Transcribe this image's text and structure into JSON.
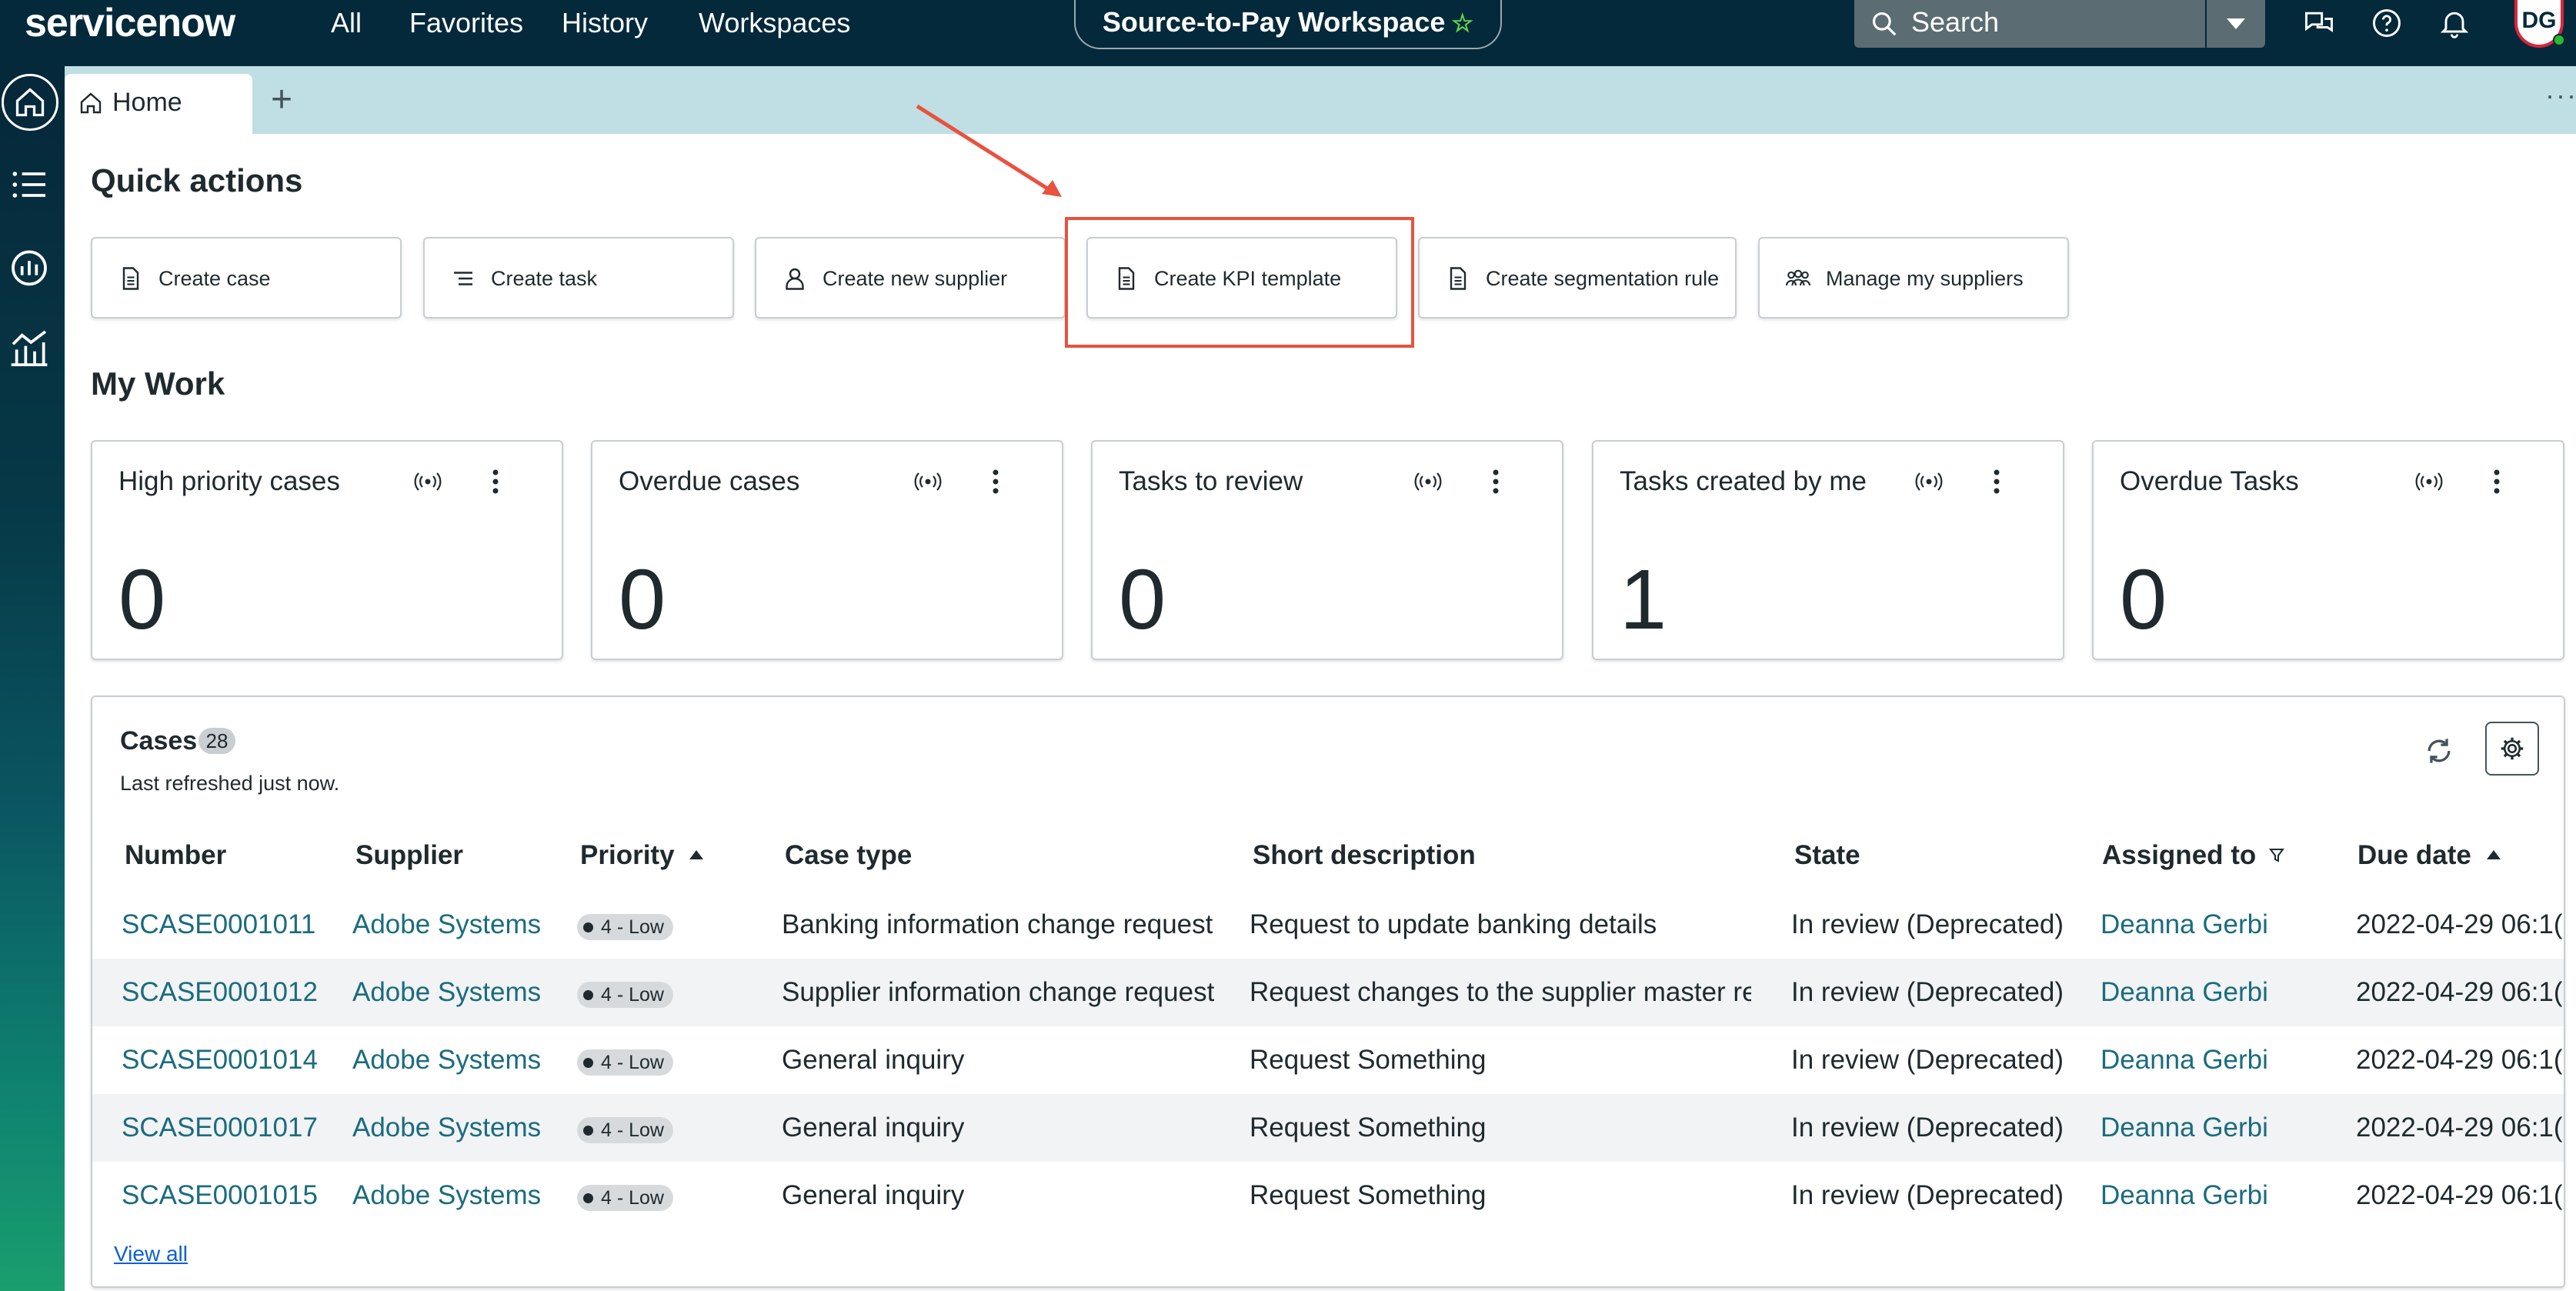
{
  "topnav": {
    "logo": "servicenow",
    "links": [
      "All",
      "Favorites",
      "History",
      "Workspaces"
    ],
    "workspace": "Source-to-Pay Workspace",
    "search_placeholder": "Search",
    "avatar_initials": "DG"
  },
  "tabs": {
    "home_label": "Home",
    "add_label": "+",
    "more_label": "···"
  },
  "quick_actions": {
    "title": "Quick actions",
    "items": [
      {
        "label": "Create case",
        "icon": "document-icon"
      },
      {
        "label": "Create task",
        "icon": "list-icon"
      },
      {
        "label": "Create new supplier",
        "icon": "person-icon"
      },
      {
        "label": "Create KPI template",
        "icon": "document-icon"
      },
      {
        "label": "Create segmentation rule",
        "icon": "document-icon"
      },
      {
        "label": "Manage my suppliers",
        "icon": "group-icon"
      }
    ],
    "highlight_color": "#e8523f"
  },
  "my_work": {
    "title": "My Work",
    "cards": [
      {
        "title": "High priority cases",
        "value": "0"
      },
      {
        "title": "Overdue cases",
        "value": "0"
      },
      {
        "title": "Tasks to review",
        "value": "0"
      },
      {
        "title": "Tasks created by me",
        "value": "1"
      },
      {
        "title": "Overdue Tasks",
        "value": "0"
      }
    ]
  },
  "cases": {
    "title": "Cases",
    "count": "28",
    "subtitle": "Last refreshed just now.",
    "columns": [
      "Number",
      "Supplier",
      "Priority",
      "Case type",
      "Short description",
      "State",
      "Assigned to",
      "Due date"
    ],
    "rows": [
      {
        "number": "SCASE0001011",
        "supplier": "Adobe Systems",
        "priority": "4 - Low",
        "case_type": "Banking information change request",
        "short_description": "Request to update banking details",
        "state": "In review (Deprecated)",
        "assigned_to": "Deanna Gerbi",
        "due_date": "2022-04-29 06:1("
      },
      {
        "number": "SCASE0001012",
        "supplier": "Adobe Systems",
        "priority": "4 - Low",
        "case_type": "Supplier information change request",
        "short_description": "Request changes to the supplier master re(",
        "state": "In review (Deprecated)",
        "assigned_to": "Deanna Gerbi",
        "due_date": "2022-04-29 06:1("
      },
      {
        "number": "SCASE0001014",
        "supplier": "Adobe Systems",
        "priority": "4 - Low",
        "case_type": "General inquiry",
        "short_description": "Request Something",
        "state": "In review (Deprecated)",
        "assigned_to": "Deanna Gerbi",
        "due_date": "2022-04-29 06:1("
      },
      {
        "number": "SCASE0001017",
        "supplier": "Adobe Systems",
        "priority": "4 - Low",
        "case_type": "General inquiry",
        "short_description": "Request Something",
        "state": "In review (Deprecated)",
        "assigned_to": "Deanna Gerbi",
        "due_date": "2022-04-29 06:1("
      },
      {
        "number": "SCASE0001015",
        "supplier": "Adobe Systems",
        "priority": "4 - Low",
        "case_type": "General inquiry",
        "short_description": "Request Something",
        "state": "In review (Deprecated)",
        "assigned_to": "Deanna Gerbi",
        "due_date": "2022-04-29 06:1("
      }
    ],
    "view_all": "View all"
  }
}
